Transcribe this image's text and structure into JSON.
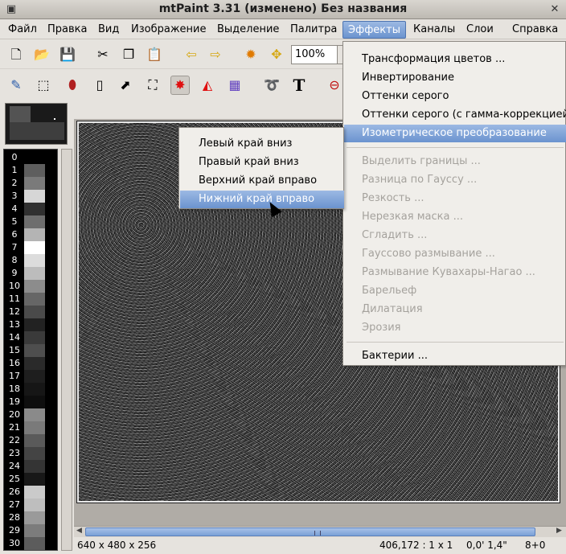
{
  "window": {
    "title": "mtPaint 3.31 (изменено) Без названия",
    "close_glyph": "✕"
  },
  "menubar": [
    {
      "label": "Файл"
    },
    {
      "label": "Правка"
    },
    {
      "label": "Вид"
    },
    {
      "label": "Изображение"
    },
    {
      "label": "Выделение"
    },
    {
      "label": "Палитра"
    },
    {
      "label": "Эффекты"
    },
    {
      "label": "Каналы"
    },
    {
      "label": "Слои"
    },
    {
      "label": "Справка"
    }
  ],
  "toolbar": {
    "zoom_value": "100%",
    "icons_row1": [
      "new-file-icon",
      "open-folder-icon",
      "save-icon",
      "cut-icon",
      "copy-icon",
      "paste-icon",
      "undo-icon",
      "redo-icon",
      "brightness-icon",
      "move-icon"
    ],
    "icons_row2": [
      "pencil-icon",
      "select-icon",
      "fill-icon",
      "ruler-icon",
      "brush-icon",
      "clone-icon",
      "smudge-icon",
      "color-pick-icon",
      "gradient-icon",
      "lasso-icon",
      "text-icon",
      "flip-icon"
    ]
  },
  "palette": {
    "numbers": [
      "0",
      "1",
      "2",
      "3",
      "4",
      "5",
      "6",
      "7",
      "8",
      "9",
      "10",
      "11",
      "12",
      "13",
      "14",
      "15",
      "16",
      "17",
      "18",
      "19",
      "20",
      "21",
      "22",
      "23",
      "24",
      "25",
      "26",
      "27",
      "28",
      "29",
      "30"
    ],
    "colors": [
      "#000000",
      "#5e5e5e",
      "#7a7a7a",
      "#d6d6d6",
      "#303030",
      "#6e6e6e",
      "#b4b4b4",
      "#ffffff",
      "#dcdcdc",
      "#bcbcbc",
      "#8c8c8c",
      "#666666",
      "#4a4a4a",
      "#222222",
      "#3a3a3a",
      "#4e4e4e",
      "#2a2a2a",
      "#1e1e1e",
      "#161616",
      "#0e0e0e",
      "#8a8a8a",
      "#7a7a7a",
      "#5a5a5a",
      "#444444",
      "#343434",
      "#181818",
      "#cacaca",
      "#bebebe",
      "#9a9a9a",
      "#7c7c7c",
      "#5c5c5c"
    ]
  },
  "effects_menu": {
    "items": [
      {
        "label": "Трансформация цветов ...",
        "disabled": false
      },
      {
        "label": "Инвертирование",
        "disabled": false
      },
      {
        "label": "Оттенки серого",
        "disabled": false
      },
      {
        "label": "Оттенки серого (с гамма-коррекцией)",
        "disabled": false
      },
      {
        "label": "Изометрическое преобразование",
        "disabled": false
      },
      {
        "label": "Выделить границы ...",
        "disabled": true
      },
      {
        "label": "Разница по Гауссу ...",
        "disabled": true
      },
      {
        "label": "Резкость ...",
        "disabled": true
      },
      {
        "label": "Нерезкая маска ...",
        "disabled": true
      },
      {
        "label": "Сгладить ...",
        "disabled": true
      },
      {
        "label": "Гауссово размывание ...",
        "disabled": true
      },
      {
        "label": "Размывание Кувахары-Нагао ...",
        "disabled": true
      },
      {
        "label": "Барельеф",
        "disabled": true
      },
      {
        "label": "Дилатация",
        "disabled": true
      },
      {
        "label": "Эрозия",
        "disabled": true
      },
      {
        "label": "Бактерии ...",
        "disabled": false
      }
    ]
  },
  "submenu": {
    "items": [
      {
        "label": "Левый край вниз"
      },
      {
        "label": "Правый край вниз"
      },
      {
        "label": "Верхний край вправо"
      },
      {
        "label": "Нижний край вправо"
      }
    ]
  },
  "statusbar": {
    "dimensions": "640 x 480 x 256",
    "position": "406,172 : 1 x 1",
    "size": "0,0' 1,4\"",
    "zoom": "8+0"
  },
  "colors": {
    "accent": "#6b93cf",
    "menu_bg": "#f0eeea",
    "disabled_text": "#a5a29d"
  }
}
